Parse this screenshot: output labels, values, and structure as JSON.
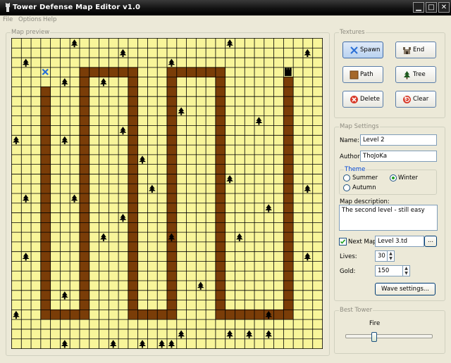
{
  "window": {
    "title": "Tower Defense Map Editor v1.0"
  },
  "menu": {
    "items": [
      "File",
      "Options",
      "Help"
    ]
  },
  "preview": {
    "label": "Map preview",
    "grid_size": 32,
    "colors": {
      "grass": "#f8f59a",
      "path": "#7a3d08",
      "grid": "#000000",
      "tree": "#000000",
      "spawn": "#2a6fd6"
    },
    "spawn": [
      3,
      3
    ],
    "end": [
      28,
      3
    ],
    "path_cells": [
      [
        3,
        5
      ],
      [
        3,
        6
      ],
      [
        3,
        7
      ],
      [
        3,
        8
      ],
      [
        3,
        9
      ],
      [
        3,
        10
      ],
      [
        3,
        11
      ],
      [
        3,
        12
      ],
      [
        3,
        13
      ],
      [
        3,
        14
      ],
      [
        3,
        15
      ],
      [
        3,
        16
      ],
      [
        3,
        17
      ],
      [
        3,
        18
      ],
      [
        3,
        19
      ],
      [
        3,
        20
      ],
      [
        3,
        21
      ],
      [
        3,
        22
      ],
      [
        3,
        23
      ],
      [
        3,
        24
      ],
      [
        3,
        25
      ],
      [
        3,
        26
      ],
      [
        3,
        27
      ],
      [
        3,
        28
      ],
      [
        4,
        28
      ],
      [
        5,
        28
      ],
      [
        6,
        28
      ],
      [
        7,
        28
      ],
      [
        7,
        27
      ],
      [
        7,
        26
      ],
      [
        7,
        25
      ],
      [
        7,
        24
      ],
      [
        7,
        23
      ],
      [
        7,
        22
      ],
      [
        7,
        21
      ],
      [
        7,
        20
      ],
      [
        7,
        19
      ],
      [
        7,
        18
      ],
      [
        7,
        17
      ],
      [
        7,
        16
      ],
      [
        7,
        15
      ],
      [
        7,
        14
      ],
      [
        7,
        13
      ],
      [
        7,
        12
      ],
      [
        7,
        11
      ],
      [
        7,
        10
      ],
      [
        7,
        9
      ],
      [
        7,
        8
      ],
      [
        7,
        7
      ],
      [
        7,
        6
      ],
      [
        7,
        5
      ],
      [
        7,
        4
      ],
      [
        7,
        3
      ],
      [
        8,
        3
      ],
      [
        9,
        3
      ],
      [
        10,
        3
      ],
      [
        11,
        3
      ],
      [
        12,
        3
      ],
      [
        12,
        4
      ],
      [
        12,
        5
      ],
      [
        12,
        6
      ],
      [
        12,
        7
      ],
      [
        12,
        8
      ],
      [
        12,
        9
      ],
      [
        12,
        10
      ],
      [
        12,
        11
      ],
      [
        12,
        12
      ],
      [
        12,
        13
      ],
      [
        12,
        14
      ],
      [
        12,
        15
      ],
      [
        12,
        16
      ],
      [
        12,
        17
      ],
      [
        12,
        18
      ],
      [
        12,
        19
      ],
      [
        12,
        20
      ],
      [
        12,
        21
      ],
      [
        12,
        22
      ],
      [
        12,
        23
      ],
      [
        12,
        24
      ],
      [
        12,
        25
      ],
      [
        12,
        26
      ],
      [
        12,
        27
      ],
      [
        12,
        28
      ],
      [
        13,
        28
      ],
      [
        14,
        28
      ],
      [
        15,
        28
      ],
      [
        16,
        28
      ],
      [
        16,
        27
      ],
      [
        16,
        26
      ],
      [
        16,
        25
      ],
      [
        16,
        24
      ],
      [
        16,
        23
      ],
      [
        16,
        22
      ],
      [
        16,
        21
      ],
      [
        16,
        20
      ],
      [
        16,
        19
      ],
      [
        16,
        18
      ],
      [
        16,
        17
      ],
      [
        16,
        16
      ],
      [
        16,
        15
      ],
      [
        16,
        14
      ],
      [
        16,
        13
      ],
      [
        16,
        12
      ],
      [
        16,
        11
      ],
      [
        16,
        10
      ],
      [
        16,
        9
      ],
      [
        16,
        8
      ],
      [
        16,
        7
      ],
      [
        16,
        6
      ],
      [
        16,
        5
      ],
      [
        16,
        4
      ],
      [
        16,
        3
      ],
      [
        17,
        3
      ],
      [
        18,
        3
      ],
      [
        19,
        3
      ],
      [
        20,
        3
      ],
      [
        21,
        3
      ],
      [
        21,
        4
      ],
      [
        21,
        5
      ],
      [
        21,
        6
      ],
      [
        21,
        7
      ],
      [
        21,
        8
      ],
      [
        21,
        9
      ],
      [
        21,
        10
      ],
      [
        21,
        11
      ],
      [
        21,
        12
      ],
      [
        21,
        13
      ],
      [
        21,
        14
      ],
      [
        21,
        15
      ],
      [
        21,
        16
      ],
      [
        21,
        17
      ],
      [
        21,
        18
      ],
      [
        21,
        19
      ],
      [
        21,
        20
      ],
      [
        21,
        21
      ],
      [
        21,
        22
      ],
      [
        21,
        23
      ],
      [
        21,
        24
      ],
      [
        21,
        25
      ],
      [
        21,
        26
      ],
      [
        21,
        27
      ],
      [
        21,
        28
      ],
      [
        22,
        28
      ],
      [
        23,
        28
      ],
      [
        24,
        28
      ],
      [
        25,
        28
      ],
      [
        26,
        28
      ],
      [
        27,
        28
      ],
      [
        28,
        28
      ],
      [
        28,
        27
      ],
      [
        28,
        26
      ],
      [
        28,
        25
      ],
      [
        28,
        24
      ],
      [
        28,
        23
      ],
      [
        28,
        22
      ],
      [
        28,
        21
      ],
      [
        28,
        20
      ],
      [
        28,
        19
      ],
      [
        28,
        18
      ],
      [
        28,
        17
      ],
      [
        28,
        16
      ],
      [
        28,
        15
      ],
      [
        28,
        14
      ],
      [
        28,
        13
      ],
      [
        28,
        12
      ],
      [
        28,
        11
      ],
      [
        28,
        10
      ],
      [
        28,
        9
      ],
      [
        28,
        8
      ],
      [
        28,
        7
      ],
      [
        28,
        6
      ],
      [
        28,
        5
      ],
      [
        28,
        4
      ]
    ],
    "trees": [
      [
        6,
        0
      ],
      [
        22,
        0
      ],
      [
        11,
        1
      ],
      [
        30,
        1
      ],
      [
        1,
        2
      ],
      [
        16,
        2
      ],
      [
        5,
        4
      ],
      [
        9,
        4
      ],
      [
        17,
        7
      ],
      [
        25,
        8
      ],
      [
        11,
        9
      ],
      [
        5,
        10
      ],
      [
        0,
        10
      ],
      [
        13,
        12
      ],
      [
        22,
        14
      ],
      [
        14,
        15
      ],
      [
        30,
        15
      ],
      [
        1,
        16
      ],
      [
        6,
        16
      ],
      [
        26,
        17
      ],
      [
        11,
        18
      ],
      [
        9,
        20
      ],
      [
        16,
        20
      ],
      [
        23,
        20
      ],
      [
        1,
        22
      ],
      [
        30,
        22
      ],
      [
        19,
        25
      ],
      [
        5,
        26
      ],
      [
        0,
        28
      ],
      [
        26,
        28
      ],
      [
        17,
        30
      ],
      [
        22,
        30
      ],
      [
        24,
        30
      ],
      [
        26,
        30
      ],
      [
        5,
        31
      ],
      [
        10,
        31
      ],
      [
        13,
        31
      ],
      [
        15,
        31
      ],
      [
        16,
        31
      ]
    ]
  },
  "textures": {
    "label": "Textures",
    "buttons": [
      {
        "id": "spawn",
        "label": "Spawn",
        "icon": "cross-icon"
      },
      {
        "id": "end",
        "label": "End",
        "icon": "castle-icon"
      },
      {
        "id": "path",
        "label": "Path",
        "icon": "path-tile-icon"
      },
      {
        "id": "tree",
        "label": "Tree",
        "icon": "tree-icon"
      },
      {
        "id": "delete",
        "label": "Delete",
        "icon": "delete-icon"
      },
      {
        "id": "clear",
        "label": "Clear",
        "icon": "clear-icon"
      }
    ]
  },
  "settings": {
    "label": "Map Settings",
    "name_label": "Name:",
    "name_value": "Level 2",
    "author_label": "Author:",
    "author_value": "ThoJoKa",
    "theme_label": "Theme",
    "theme_options": [
      "Summer",
      "Winter",
      "Autumn"
    ],
    "theme_selected": "Winter",
    "description_label": "Map description:",
    "description_value": "The second level - still easy",
    "next_map_label": "Next Map",
    "next_map_checked": true,
    "next_map_value": "Level 3.td",
    "browse_label": "...",
    "lives_label": "Lives:",
    "lives_value": "30",
    "gold_label": "Gold:",
    "gold_value": "150",
    "wave_button": "Wave settings..."
  },
  "best_tower": {
    "label": "Best Tower",
    "value": "Fire",
    "level": 0.33
  }
}
